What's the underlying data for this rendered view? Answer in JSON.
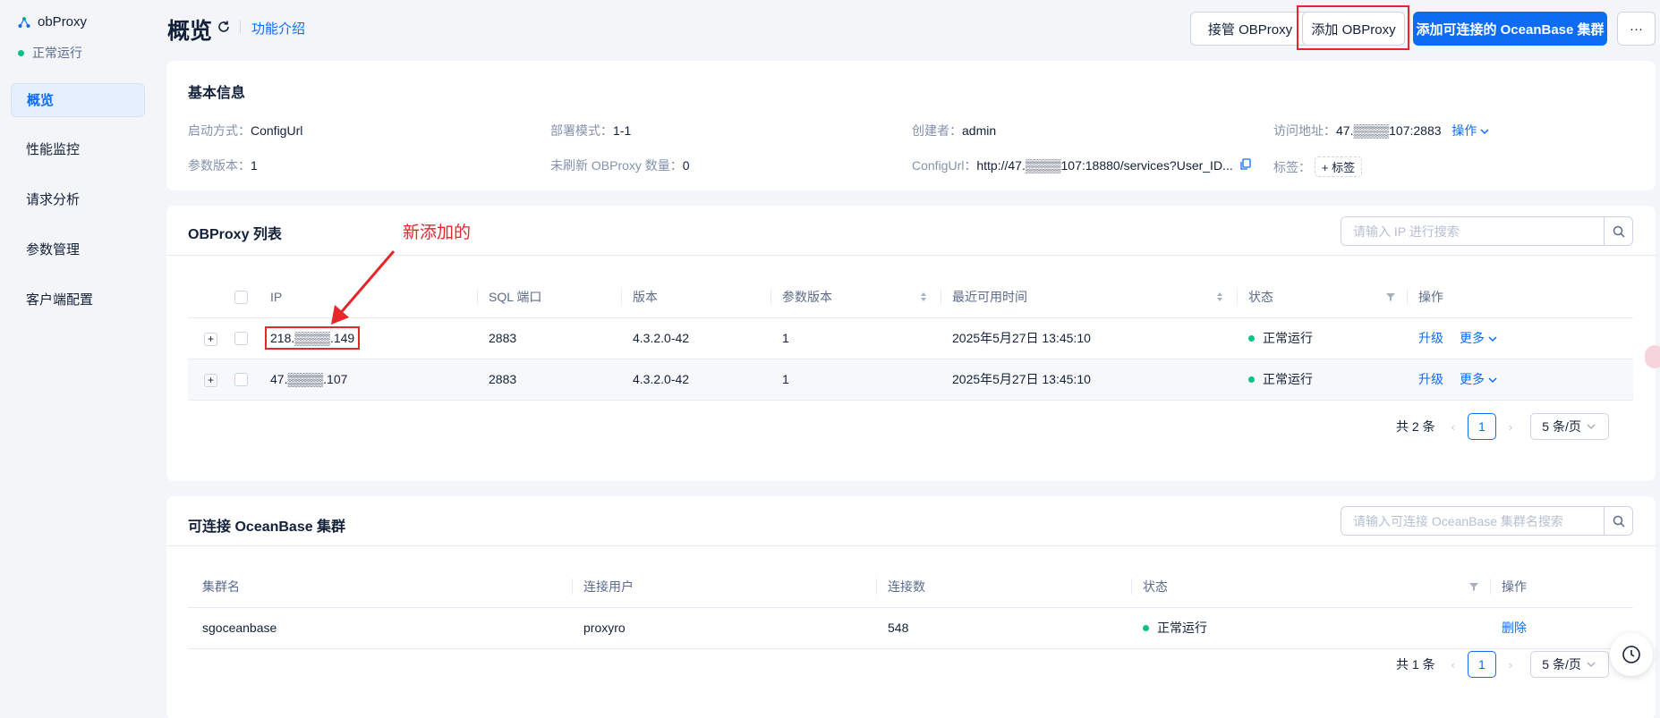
{
  "sidebar": {
    "app_name": "obProxy",
    "status": "正常运行",
    "items": [
      {
        "label": "概览"
      },
      {
        "label": "性能监控"
      },
      {
        "label": "请求分析"
      },
      {
        "label": "参数管理"
      },
      {
        "label": "客户端配置"
      }
    ]
  },
  "header": {
    "title": "概览",
    "intro_link": "功能介绍",
    "btn_takeover": "接管 OBProxy",
    "btn_add": "添加 OBProxy",
    "btn_add_cluster": "添加可连接的 OceanBase 集群",
    "btn_more": "···"
  },
  "basic_info": {
    "title": "基本信息",
    "start_mode_label": "启动方式：",
    "start_mode": "ConfigUrl",
    "deploy_label": "部署模式：",
    "deploy": "1-1",
    "creator_label": "创建者：",
    "creator": "admin",
    "access_label": "访问地址：",
    "access": "47.▒▒▒▒107:2883",
    "op_label": "操作",
    "param_version_label": "参数版本：",
    "param_version": "1",
    "unrefreshed_label": "未刷新 OBProxy 数量：",
    "unrefreshed": "0",
    "configurl_label": "ConfigUrl：",
    "configurl": "http://47.▒▒▒▒107:18880/services?User_ID...",
    "tags_label": "标签：",
    "tag_button": "+ 标签"
  },
  "proxy_list": {
    "title": "OBProxy 列表",
    "search_placeholder": "请输入 IP 进行搜索",
    "columns": [
      "IP",
      "SQL 端口",
      "版本",
      "参数版本",
      "最近可用时间",
      "状态",
      "操作"
    ],
    "rows": [
      {
        "ip": "218.▒▒▒▒.149",
        "port": "2883",
        "version": "4.3.2.0-42",
        "param_version": "1",
        "time": "2025年5月27日 13:45:10",
        "status": "正常运行",
        "upgrade": "升级",
        "more": "更多"
      },
      {
        "ip": "47.▒▒▒▒.107",
        "port": "2883",
        "version": "4.3.2.0-42",
        "param_version": "1",
        "time": "2025年5月27日 13:45:10",
        "status": "正常运行",
        "upgrade": "升级",
        "more": "更多"
      }
    ],
    "total": "共 2 条",
    "page": "1",
    "page_size": "5 条/页"
  },
  "cluster_list": {
    "title": "可连接 OceanBase 集群",
    "search_placeholder": "请输入可连接 OceanBase 集群名搜索",
    "columns": [
      "集群名",
      "连接用户",
      "连接数",
      "状态",
      "操作"
    ],
    "rows": [
      {
        "name": "sgoceanbase",
        "user": "proxyro",
        "connections": "548",
        "status": "正常运行",
        "action": "删除"
      }
    ],
    "total": "共 1 条",
    "page": "1",
    "page_size": "5 条/页"
  },
  "annotation": "新添加的",
  "colors": {
    "primary": "#0d6cf2",
    "success": "#0ac185",
    "annotation": "#e5262a"
  }
}
